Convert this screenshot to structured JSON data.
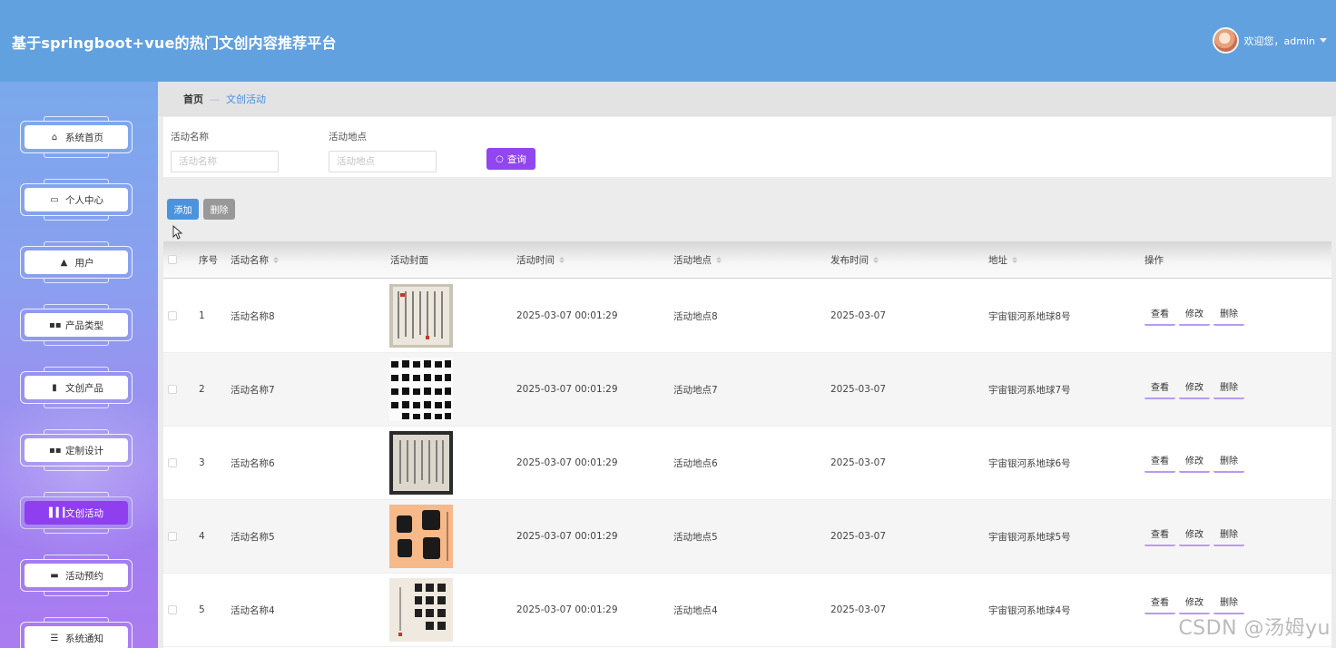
{
  "header": {
    "title": "基于springboot+vue的热门文创内容推荐平台",
    "welcome": "欢迎您，admin"
  },
  "sidebar": {
    "items": [
      {
        "label": "系统首页",
        "icon": "home-icon",
        "active": false
      },
      {
        "label": "个人中心",
        "icon": "profile-card-icon",
        "active": false
      },
      {
        "label": "用户",
        "icon": "user-icon",
        "active": false
      },
      {
        "label": "产品类型",
        "icon": "grid-icon",
        "active": false
      },
      {
        "label": "文创产品",
        "icon": "clipboard-icon",
        "active": false
      },
      {
        "label": "定制设计",
        "icon": "grid-icon",
        "active": false
      },
      {
        "label": "文创活动",
        "icon": "bar-chart-icon",
        "active": true
      },
      {
        "label": "活动预约",
        "icon": "comment-icon",
        "active": false
      },
      {
        "label": "系统通知",
        "icon": "menu-list-icon",
        "active": false
      }
    ]
  },
  "breadcrumb": {
    "home": "首页",
    "separator": "—",
    "current": "文创活动"
  },
  "search": {
    "name_label": "活动名称",
    "name_placeholder": "活动名称",
    "location_label": "活动地点",
    "location_placeholder": "活动地点",
    "query_label": "查询"
  },
  "actions": {
    "add_label": "添加",
    "delete_label": "删除"
  },
  "table": {
    "columns": [
      "序号",
      "活动名称",
      "活动封面",
      "活动时间",
      "活动地点",
      "发布时间",
      "地址",
      "操作"
    ],
    "rows": [
      {
        "index": "1",
        "name": "活动名称8",
        "time": "2025-03-07 00:01:29",
        "location": "活动地点8",
        "publish": "2025-03-07",
        "address": "宇宙银河系地球8号"
      },
      {
        "index": "2",
        "name": "活动名称7",
        "time": "2025-03-07 00:01:29",
        "location": "活动地点7",
        "publish": "2025-03-07",
        "address": "宇宙银河系地球7号"
      },
      {
        "index": "3",
        "name": "活动名称6",
        "time": "2025-03-07 00:01:29",
        "location": "活动地点6",
        "publish": "2025-03-07",
        "address": "宇宙银河系地球6号"
      },
      {
        "index": "4",
        "name": "活动名称5",
        "time": "2025-03-07 00:01:29",
        "location": "活动地点5",
        "publish": "2025-03-07",
        "address": "宇宙银河系地球5号"
      },
      {
        "index": "5",
        "name": "活动名称4",
        "time": "2025-03-07 00:01:29",
        "location": "活动地点4",
        "publish": "2025-03-07",
        "address": "宇宙银河系地球4号"
      }
    ],
    "ops": {
      "view": "查看",
      "edit": "修改",
      "delete": "删除"
    }
  },
  "watermark": "CSDN @汤姆yu",
  "colors": {
    "header": "#62a1df",
    "accent": "#9146f0",
    "add": "#4c93de",
    "delete": "#989898"
  }
}
